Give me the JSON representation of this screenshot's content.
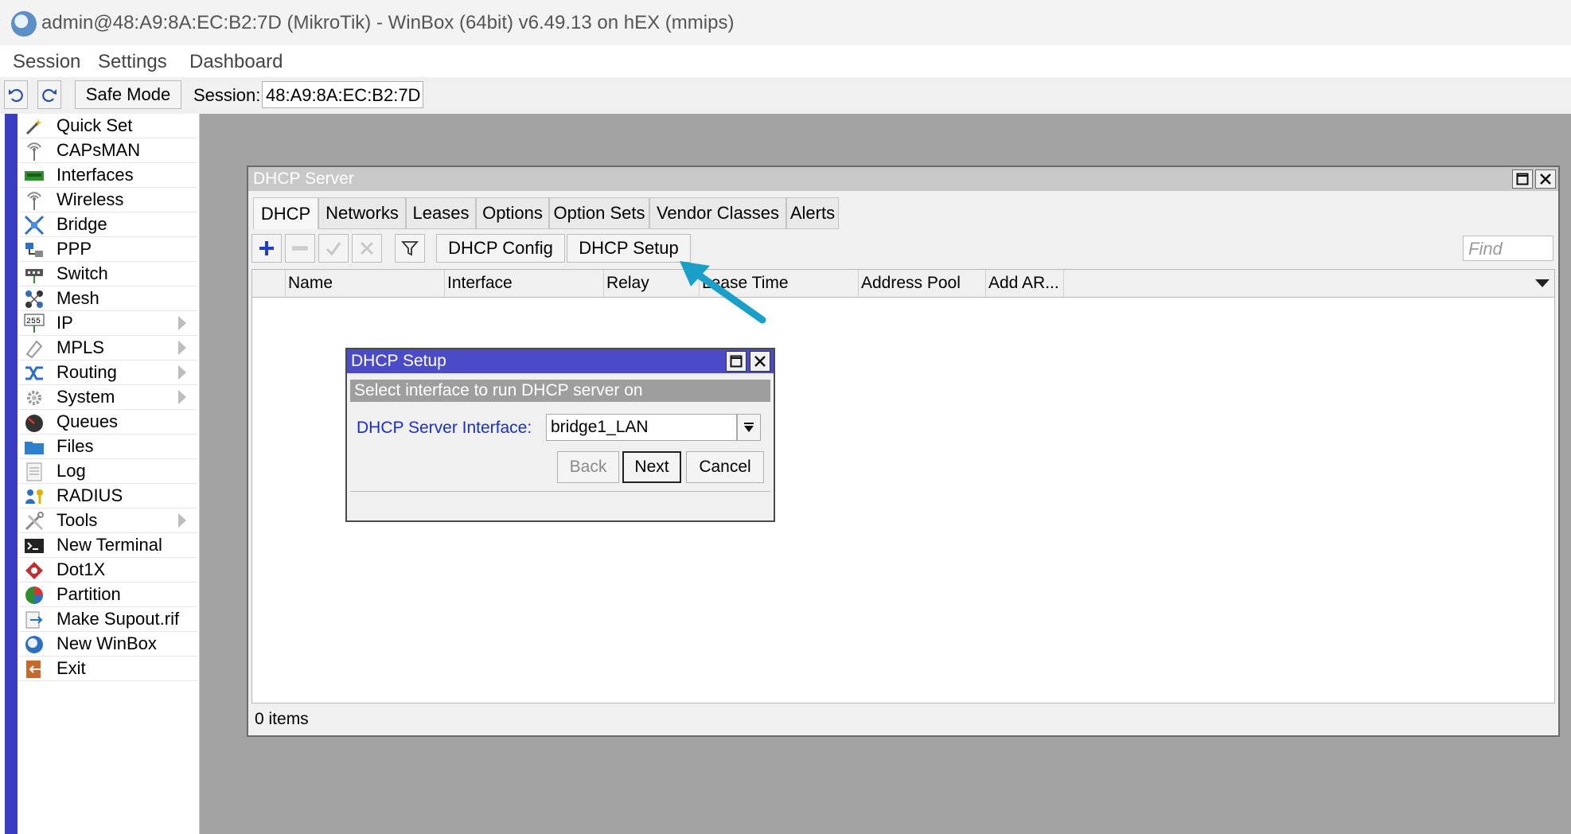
{
  "window": {
    "title": "admin@48:A9:8A:EC:B2:7D (MikroTik) - WinBox (64bit) v6.49.13 on hEX (mmips)"
  },
  "menu": {
    "items": [
      "Session",
      "Settings",
      "Dashboard"
    ]
  },
  "toolbar": {
    "safe_mode": "Safe Mode",
    "session_label": "Session:",
    "session_value": "48:A9:8A:EC:B2:7D"
  },
  "sidebar": {
    "items": [
      {
        "label": "Quick Set",
        "icon": "magic-wand-icon"
      },
      {
        "label": "CAPsMAN",
        "icon": "antenna-icon"
      },
      {
        "label": "Interfaces",
        "icon": "network-card-icon"
      },
      {
        "label": "Wireless",
        "icon": "wireless-icon"
      },
      {
        "label": "Bridge",
        "icon": "bridge-icon"
      },
      {
        "label": "PPP",
        "icon": "ppp-icon"
      },
      {
        "label": "Switch",
        "icon": "switch-icon"
      },
      {
        "label": "Mesh",
        "icon": "mesh-icon"
      },
      {
        "label": "IP",
        "icon": "ip-icon",
        "submenu": true
      },
      {
        "label": "MPLS",
        "icon": "mpls-icon",
        "submenu": true
      },
      {
        "label": "Routing",
        "icon": "routing-icon",
        "submenu": true
      },
      {
        "label": "System",
        "icon": "gear-icon",
        "submenu": true
      },
      {
        "label": "Queues",
        "icon": "gauge-icon"
      },
      {
        "label": "Files",
        "icon": "folder-icon"
      },
      {
        "label": "Log",
        "icon": "log-icon"
      },
      {
        "label": "RADIUS",
        "icon": "users-key-icon"
      },
      {
        "label": "Tools",
        "icon": "tools-icon",
        "submenu": true
      },
      {
        "label": "New Terminal",
        "icon": "terminal-icon"
      },
      {
        "label": "Dot1X",
        "icon": "dot1x-icon"
      },
      {
        "label": "Partition",
        "icon": "pie-chart-icon"
      },
      {
        "label": "Make Supout.rif",
        "icon": "export-icon"
      },
      {
        "label": "New WinBox",
        "icon": "winbox-icon"
      },
      {
        "label": "Exit",
        "icon": "exit-icon"
      }
    ]
  },
  "dhcp_server": {
    "title": "DHCP Server",
    "tabs": [
      "DHCP",
      "Networks",
      "Leases",
      "Options",
      "Option Sets",
      "Vendor Classes",
      "Alerts"
    ],
    "active_tab": "DHCP",
    "buttons": {
      "config": "DHCP Config",
      "setup": "DHCP Setup"
    },
    "find_placeholder": "Find",
    "columns": [
      "Name",
      "Interface",
      "Relay",
      "Lease Time",
      "Address Pool",
      "Add AR..."
    ],
    "status": "0 items"
  },
  "dhcp_setup": {
    "title": "DHCP Setup",
    "instruction": "Select interface to run DHCP server on",
    "field_label": "DHCP Server Interface:",
    "field_value": "bridge1_LAN",
    "back": "Back",
    "next": "Next",
    "cancel": "Cancel"
  },
  "colors": {
    "accent": "#3a3cc4",
    "dialog_title": "#4b4bc8",
    "annotation_arrow": "#1aa0c8",
    "label_blue": "#1a2ecb"
  }
}
